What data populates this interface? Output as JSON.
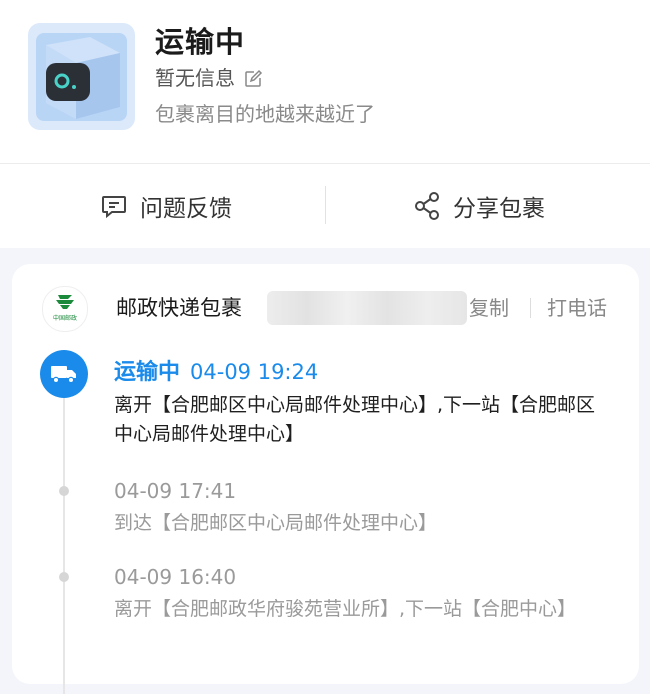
{
  "summary": {
    "status_title": "运输中",
    "sub_status": "暂无信息",
    "description": "包裹离目的地越来越近了"
  },
  "actions": {
    "feedback_label": "问题反馈",
    "share_label": "分享包裹"
  },
  "carrier": {
    "logo_text": "中国邮政",
    "name": "邮政快递包裹",
    "copy_label": "复制",
    "call_label": "打电话"
  },
  "events": [
    {
      "status": "运输中",
      "time": "04-09 19:24",
      "desc": "离开【合肥邮区中心局邮件处理中心】,下一站【合肥邮区中心局邮件处理中心】"
    },
    {
      "time": "04-09 17:41",
      "desc": "到达【合肥邮区中心局邮件处理中心】"
    },
    {
      "time": "04-09 16:40",
      "desc": "离开【合肥邮政华府骏苑营业所】,下一站【合肥中心】"
    }
  ],
  "colors": {
    "accent": "#1a8bea",
    "muted": "#9a9a9a",
    "background": "#f3f5fa"
  },
  "icons": {
    "package": "package-box-icon",
    "edit": "edit-icon",
    "feedback": "message-icon",
    "share": "share-icon",
    "truck": "truck-icon"
  }
}
